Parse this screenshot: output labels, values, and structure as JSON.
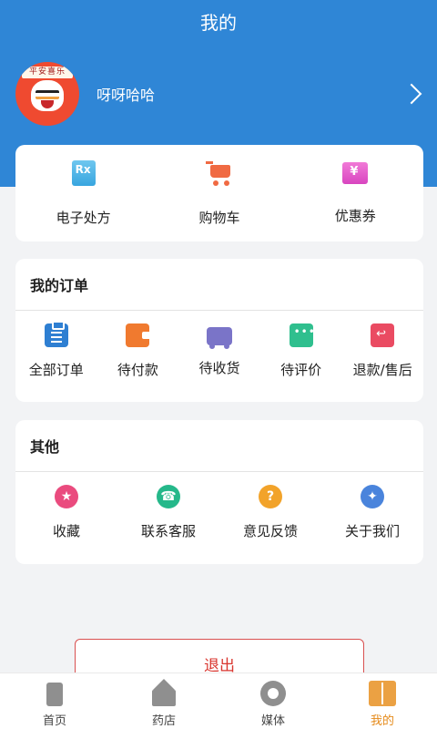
{
  "header": {
    "title": "我的"
  },
  "profile": {
    "name": "呀呀哈哈",
    "avatar_text": "平安喜乐"
  },
  "quick": [
    {
      "label": "电子处方",
      "icon": "prescription-icon"
    },
    {
      "label": "购物车",
      "icon": "cart-icon"
    },
    {
      "label": "优惠券",
      "icon": "coupon-icon"
    }
  ],
  "orders": {
    "title": "我的订单",
    "items": [
      {
        "label": "全部订单",
        "icon": "clipboard-icon"
      },
      {
        "label": "待付款",
        "icon": "wallet-icon"
      },
      {
        "label": "待收货",
        "icon": "truck-icon"
      },
      {
        "label": "待评价",
        "icon": "comment-icon"
      },
      {
        "label": "退款/售后",
        "icon": "refund-icon"
      }
    ]
  },
  "other": {
    "title": "其他",
    "items": [
      {
        "label": "收藏",
        "icon": "star-icon",
        "glyph": "★"
      },
      {
        "label": "联系客服",
        "icon": "service-icon",
        "glyph": "☎"
      },
      {
        "label": "意见反馈",
        "icon": "question-icon",
        "glyph": "?"
      },
      {
        "label": "关于我们",
        "icon": "users-icon",
        "glyph": "✦"
      }
    ]
  },
  "logout_label": "退出",
  "tabs": [
    {
      "label": "首页",
      "icon": "home-icon"
    },
    {
      "label": "药店",
      "icon": "store-icon"
    },
    {
      "label": "媒体",
      "icon": "media-icon"
    },
    {
      "label": "我的",
      "icon": "mine-icon",
      "active": true
    }
  ],
  "colors": {
    "primary": "#2f86d6",
    "tab_active": "#e58a1a",
    "logout": "#d9362f"
  }
}
